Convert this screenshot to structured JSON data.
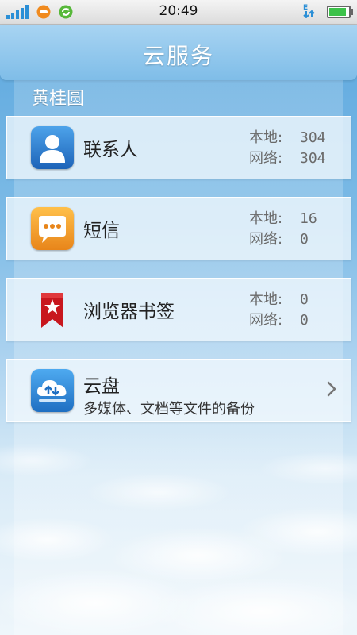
{
  "status_bar": {
    "time": "20:49"
  },
  "header": {
    "title": "云服务"
  },
  "section": {
    "label": "黄桂圆"
  },
  "items": [
    {
      "name": "联系人",
      "icon": "contacts-icon",
      "local_label": "本地:",
      "local_value": "304",
      "network_label": "网络:",
      "network_value": "304"
    },
    {
      "name": "短信",
      "icon": "messages-icon",
      "local_label": "本地:",
      "local_value": "16",
      "network_label": "网络:",
      "network_value": "0"
    },
    {
      "name": "浏览器书签",
      "icon": "bookmark-icon",
      "local_label": "本地:",
      "local_value": "0",
      "network_label": "网络:",
      "network_value": "0"
    },
    {
      "name": "云盘",
      "icon": "cloud-drive-icon",
      "subtitle": "多媒体、文档等文件的备份"
    }
  ],
  "colors": {
    "accent": "#2b8fd6",
    "title_bar": "#8cc6ec",
    "battery": "#3cc24a"
  }
}
